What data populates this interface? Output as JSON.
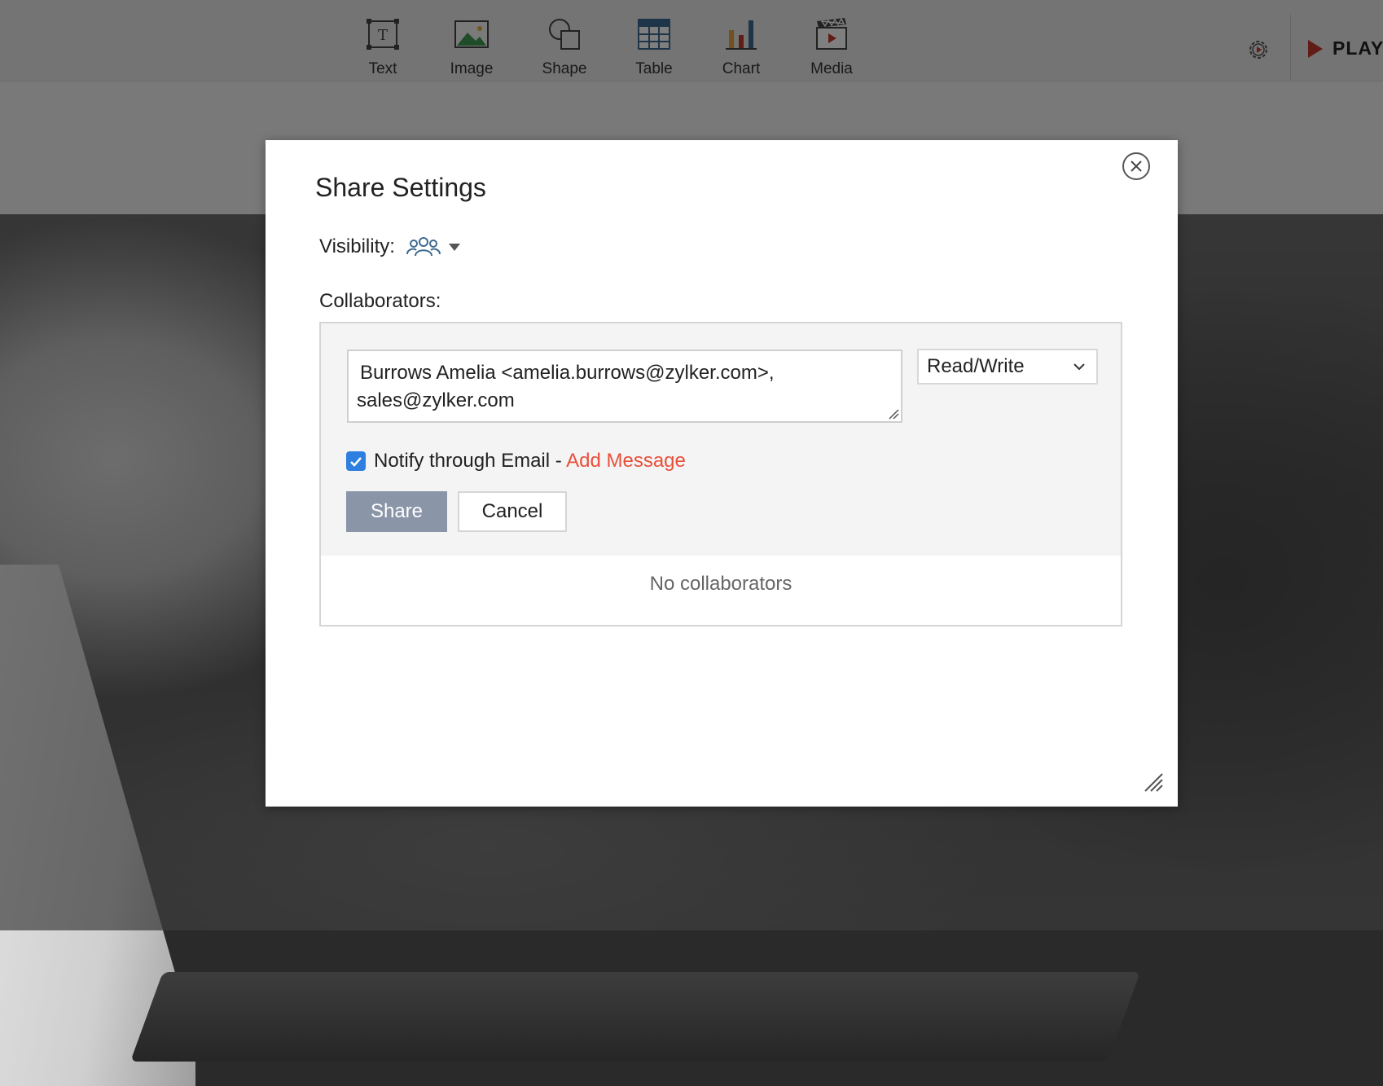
{
  "toolbar": {
    "items": [
      {
        "label": "Text",
        "icon": "text-box-icon"
      },
      {
        "label": "Image",
        "icon": "image-icon"
      },
      {
        "label": "Shape",
        "icon": "shape-icon"
      },
      {
        "label": "Table",
        "icon": "table-icon"
      },
      {
        "label": "Chart",
        "icon": "bar-chart-icon"
      },
      {
        "label": "Media",
        "icon": "clapperboard-icon"
      }
    ],
    "play_label": "PLAY",
    "play_color": "#c0392b"
  },
  "dialog": {
    "title": "Share Settings",
    "visibility_label": "Visibility:",
    "visibility_icon": "group-icon",
    "collaborators_label": "Collaborators:",
    "email_value_line1": "Burrows Amelia <amelia.burrows@zylker.com>,",
    "email_value_line2": "sales@zylker.com",
    "permission_selected": "Read/Write",
    "notify_checked": true,
    "notify_label": "Notify through Email - ",
    "add_message_label": "Add Message",
    "share_label": "Share",
    "cancel_label": "Cancel",
    "empty_state": "No collaborators",
    "colors": {
      "accent_link": "#e8503a",
      "checkbox": "#2f7fe0",
      "share_button": "#8a95a8"
    }
  }
}
